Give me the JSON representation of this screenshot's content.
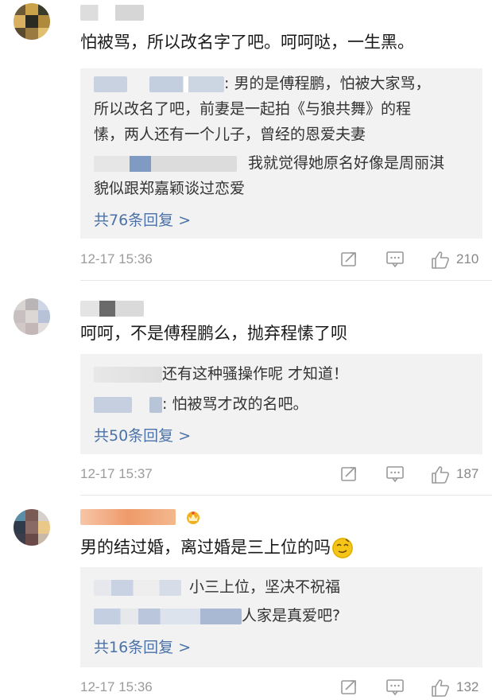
{
  "comments": [
    {
      "text": "怕被骂，所以改名字了吧。呵呵哒，一生黑。",
      "replies": [
        {
          "text_a": ": 男的是傅程鹏，怕被大家骂，",
          "text_b": "所以改名了吧，前妻是一起拍《与狼共舞》的程",
          "text_c": "愫，两人还有一个儿子，曾经的恩爱夫妻"
        },
        {
          "text_a": "我就觉得她原名好像是周丽淇",
          "text_b": "貌似跟郑嘉颖谈过恋爱"
        }
      ],
      "more": "共76条回复 >",
      "time": "12-17 15:36",
      "likes": "210"
    },
    {
      "text": "呵呵，不是傅程鹏么，抛弃程愫了呗",
      "replies": [
        {
          "text_a": "还有这种骚操作呢 才知道！"
        },
        {
          "text_a": ": 怕被骂才改的名吧。"
        }
      ],
      "more": "共50条回复 >",
      "time": "12-17 15:37",
      "likes": "187"
    },
    {
      "text": "男的结过婚，离过婚是三上位的吗",
      "replies": [
        {
          "text_a": "小三上位，坚决不祝福"
        },
        {
          "text_a": "人家是真爱吧?"
        }
      ],
      "more": "共16条回复 >",
      "time": "12-17 15:36",
      "likes": "132"
    }
  ],
  "colors": {
    "link": "#4a72a8",
    "muted": "#9b9b9b",
    "reply_bg": "#f2f2f2"
  },
  "icons": [
    "share-icon",
    "comment-icon",
    "like-icon",
    "emoji-icon"
  ]
}
